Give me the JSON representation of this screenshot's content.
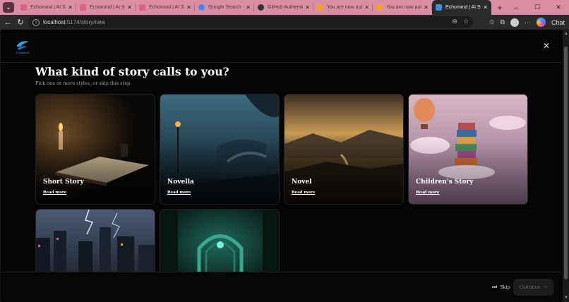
{
  "browser": {
    "tabs": [
      {
        "title": "Echomind | AI Stor",
        "favicon_color": "#e0608a"
      },
      {
        "title": "Echomind | AI Stor",
        "favicon_color": "#e0608a"
      },
      {
        "title": "Echomind | AI Stor",
        "favicon_color": "#e0608a"
      },
      {
        "title": "Google Search - To",
        "favicon_color": "#4285f4"
      },
      {
        "title": "GitHub Authenticat",
        "favicon_color": "#333333"
      },
      {
        "title": "You are now author",
        "favicon_color": "#f0a030"
      },
      {
        "title": "You are now author",
        "favicon_color": "#f0a030"
      },
      {
        "title": "Echomind | AI Stor",
        "favicon_color": "#3a8fd6",
        "active": true
      }
    ],
    "url_host": "localhost",
    "url_path": ":5174/story/new",
    "chat_label": "Chat"
  },
  "modal": {
    "logo_text": "EchoMind",
    "title": "What kind of story calls to you?",
    "subtitle": "Pick one or more styles, or skip this step.",
    "cards": [
      {
        "name": "Short Story",
        "more": "Read more"
      },
      {
        "name": "Novella",
        "more": "Read more"
      },
      {
        "name": "Novel",
        "more": "Read more"
      },
      {
        "name": "Children's Story",
        "more": "Read more"
      },
      {
        "name": "",
        "more": ""
      },
      {
        "name": "",
        "more": ""
      }
    ],
    "skip_label": "Skip",
    "continue_label": "Continue"
  }
}
